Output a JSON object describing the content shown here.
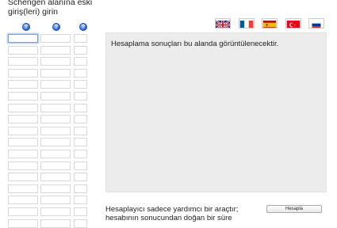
{
  "form": {
    "title": "Schengen alanına eski giriş(leri) girin",
    "help_icon_glyph": "?",
    "row_count": 17
  },
  "languages": [
    {
      "name": "English",
      "icon": "uk-flag"
    },
    {
      "name": "Français",
      "icon": "france-flag"
    },
    {
      "name": "Español",
      "icon": "spain-flag"
    },
    {
      "name": "Türkçe",
      "icon": "turkey-flag"
    },
    {
      "name": "Русский",
      "icon": "russia-flag"
    }
  ],
  "result": {
    "placeholder_text": "Hesaplama sonuçları bu alanda görüntülenecektir."
  },
  "footer": {
    "note_text": "Hesaplayıcı sadece yardımcı bir araçtır; hesabının sonucundan doğan bir süre",
    "calculate_label": "Hesapla"
  },
  "colors": {
    "result_bg": "#ececec",
    "help_icon": "#2a63d8",
    "focus_ring": "#6ea2e6"
  }
}
